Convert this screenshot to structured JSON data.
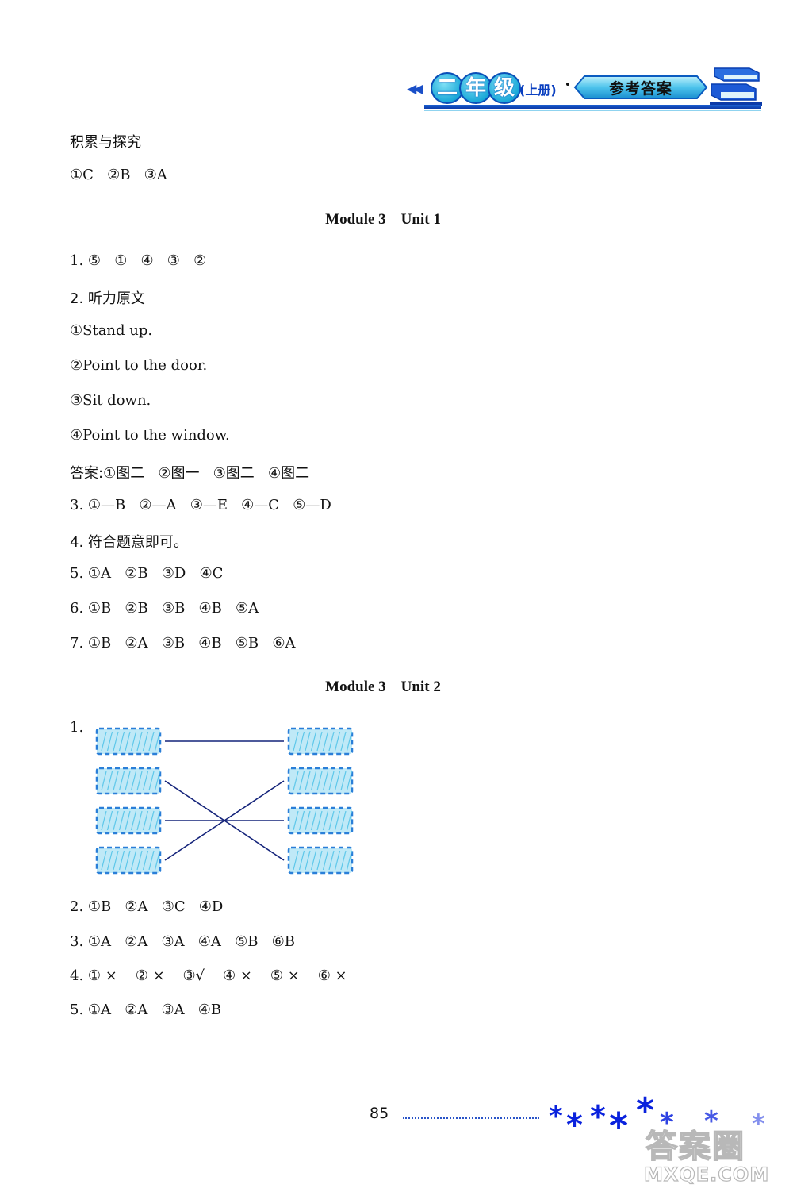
{
  "header": {
    "grade_chars": [
      "二",
      "年",
      "级"
    ],
    "term": "(上册)",
    "tag": "参考答案",
    "arrows": "◀◀",
    "icons": [
      "double-left-arrow-icon",
      "books-icon"
    ]
  },
  "sections": [
    {
      "title": "积累与探究",
      "lines": [
        "①C   ②B   ③A"
      ]
    }
  ],
  "module3_unit1": {
    "title": "Module 3    Unit 1",
    "q1": "1. ⑤   ①   ④   ③   ②",
    "q2_heading": "2. 听力原文",
    "q2_script": [
      "①Stand up.",
      "②Point to the door.",
      "③Sit down.",
      "④Point to the window."
    ],
    "q2_answer": "答案:①图二   ②图一   ③图二   ④图二",
    "q3": "3. ①—B   ②—A   ③—E   ④—C   ⑤—D",
    "q4": "4. 符合题意即可。",
    "q5": "5. ①A   ②B   ③D   ④C",
    "q6": "6. ①B   ②B   ③B   ④B   ⑤A",
    "q7": "7. ①B   ②A   ③B   ④B   ⑤B   ⑥A"
  },
  "module3_unit2": {
    "title": "Module 3    Unit 2",
    "q1_label": "1.",
    "q1_matching": {
      "left_items": 4,
      "right_items": 4,
      "connections": [
        [
          1,
          1
        ],
        [
          2,
          4
        ],
        [
          3,
          3
        ],
        [
          4,
          2
        ]
      ]
    },
    "q2": "2. ①B   ②A   ③C   ④D",
    "q3": "3. ①A   ②A   ③A   ④A   ⑤B   ⑥B",
    "q4": "4. ① ×    ② ×    ③√    ④ ×    ⑤ ×    ⑥ ×",
    "q5": "5. ①A   ②A   ③A   ④B"
  },
  "footer": {
    "page_number": "85",
    "star_glyph": "*",
    "watermark_cn": "答案圈",
    "watermark_en": "MXQE.COM"
  },
  "colors": {
    "accent_blue": "#0a22dd",
    "header_blue": "#1c5fd0",
    "box_cyan": "#5fc8ea",
    "line_navy": "#14237a"
  }
}
